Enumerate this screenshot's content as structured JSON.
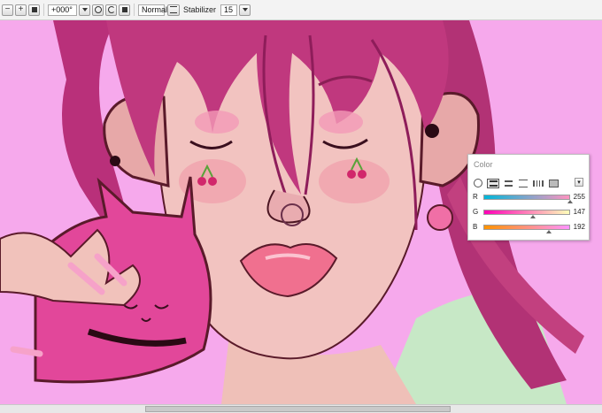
{
  "toolbar": {
    "rotation_value": "+000°",
    "blend_mode": "Normal",
    "stabilizer_label": "Stabilizer",
    "stabilizer_value": "15",
    "minus_glyph": "−",
    "plus_glyph": "+",
    "icons": [
      "zoom-out-icon",
      "zoom-in-icon",
      "fit-icon",
      "rotation-dropdown-icon",
      "rotate-reset-icon",
      "rotate-icon",
      "flip-icon",
      "mode-settings-icon",
      "stabilizer-dropdown-icon"
    ]
  },
  "color_panel": {
    "title": "Color",
    "menu_glyph": "▾",
    "modes": [
      "color-wheel-icon",
      "rgb-slider-icon",
      "hsv-slider-icon",
      "palette-list-icon",
      "swatch-grid-icon",
      "user-palette-icon"
    ],
    "active_mode_index": 1,
    "sliders": [
      {
        "label": "R",
        "value": "255",
        "level": 1.0,
        "gradient": [
          "#00b6d8",
          "#ff93c0"
        ]
      },
      {
        "label": "G",
        "value": "147",
        "level": 0.576,
        "gradient": [
          "#ff00b7",
          "#ffffb9"
        ]
      },
      {
        "label": "B",
        "value": "192",
        "level": 0.753,
        "gradient": [
          "#ff9300",
          "#ff93ff"
        ]
      }
    ]
  },
  "canvas": {
    "background_color": "#f6a9ec",
    "hair_color": "#c0387e",
    "skin_color": "#f2c3c0",
    "lip_color": "#f0708f"
  },
  "scrollbar": {
    "position": 0.24
  }
}
